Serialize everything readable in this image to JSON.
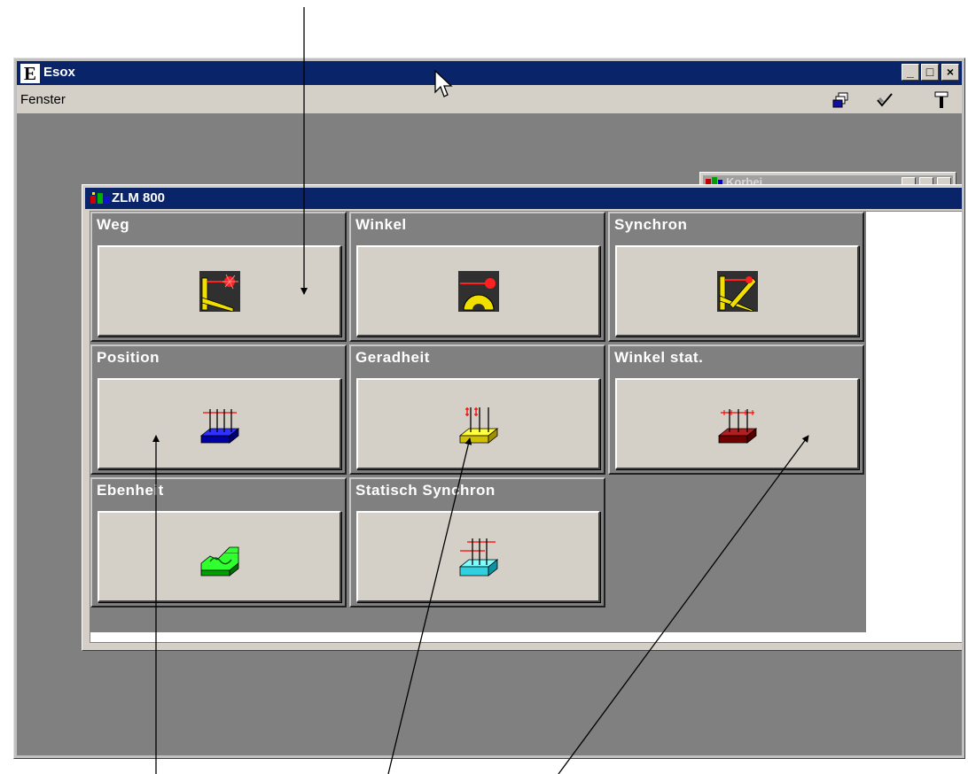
{
  "app": {
    "logo_letter": "E",
    "title": "Esox",
    "window_buttons": {
      "minimize": "_",
      "maximize": "□",
      "close": "×"
    }
  },
  "menubar": {
    "items": [
      "Fenster"
    ],
    "toolbar_icons": [
      "cascade-windows-icon",
      "check-wand-icon",
      "wrench-icon"
    ]
  },
  "background_window": {
    "title": "Korbei"
  },
  "zlm_window": {
    "title": "ZLM 800",
    "panels": [
      {
        "label": "Weg",
        "icon": "laser-ruler-icon"
      },
      {
        "label": "Winkel",
        "icon": "laser-protractor-icon"
      },
      {
        "label": "Synchron",
        "icon": "laser-dual-ruler-icon"
      },
      {
        "label": "Position",
        "icon": "position-plate-icon",
        "color": "#1010c8"
      },
      {
        "label": "Geradheit",
        "icon": "straightness-plate-icon",
        "color": "#f0e000"
      },
      {
        "label": "Winkel stat.",
        "icon": "static-angle-plate-icon",
        "color": "#8b0000"
      },
      {
        "label": "Ebenheit",
        "icon": "flatness-plate-icon",
        "color": "#00c000"
      },
      {
        "label": "Statisch Synchron",
        "icon": "static-sync-plate-icon",
        "color": "#30d0e0"
      }
    ]
  },
  "colors": {
    "titlebar": "#0a246a",
    "workspace": "#808080",
    "button_face": "#d4d0c8"
  }
}
